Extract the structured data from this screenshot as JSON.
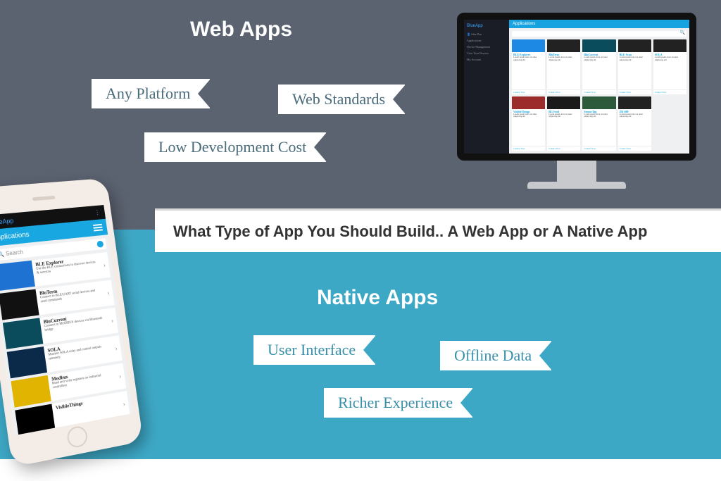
{
  "top": {
    "title": "Web Apps",
    "ribbons": {
      "any_platform": "Any Platform",
      "web_standards": "Web Standards",
      "low_dev_cost": "Low Development Cost"
    }
  },
  "center_banner": "What Type of App You Should Build.. A Web App or A Native App",
  "bottom": {
    "title": "Native Apps",
    "ribbons": {
      "user_interface": "User Interface",
      "offline_data": "Offline Data",
      "richer_experience": "Richer Experience"
    }
  },
  "monitor": {
    "brand": "BlueApp",
    "sidebar": {
      "user": "John Doe",
      "items": [
        "Applications",
        "Device Management",
        "View Your Devices",
        "My Account"
      ]
    },
    "header": "Applications",
    "search_placeholder": "Search",
    "cards": [
      {
        "title": "BLE Explorer",
        "thumb": "thumb-blue"
      },
      {
        "title": "BluTerm",
        "thumb": "thumb-dark"
      },
      {
        "title": "BluCurrent",
        "thumb": "thumb-teal"
      },
      {
        "title": "BLE Scan",
        "thumb": "thumb-dark"
      },
      {
        "title": "SOLA",
        "thumb": "thumb-dark"
      },
      {
        "title": "VisibleThings",
        "thumb": "thumb-red"
      },
      {
        "title": "BLI-tool",
        "thumb": "thumb-chip"
      },
      {
        "title": "SensorTag",
        "thumb": "thumb-green"
      },
      {
        "title": "ZR-400",
        "thumb": "thumb-dark"
      }
    ],
    "card_footer": "Connect Now"
  },
  "phone": {
    "brand": "BlueApp",
    "header": "Applications",
    "search_placeholder": "Search",
    "list": [
      {
        "title": "BLE Explorer",
        "desc": "Use the BLE connections to discover devices & services",
        "thumb": "t-blue"
      },
      {
        "title": "BluTerm",
        "desc": "Connect to BLE/UART serial devices and send commands",
        "thumb": "t-dark"
      },
      {
        "title": "BluCurrent",
        "desc": "Connect to MODBUS devices via Bluetooth bridge",
        "thumb": "t-teal"
      },
      {
        "title": "SOLA",
        "desc": "Monitor SOLA relay and control outputs remotely",
        "thumb": "t-navy"
      },
      {
        "title": "Modbus",
        "desc": "Read and write registers on industrial controllers",
        "thumb": "t-yellow"
      },
      {
        "title": "VisibleThings",
        "desc": "",
        "thumb": "t-black"
      }
    ]
  }
}
